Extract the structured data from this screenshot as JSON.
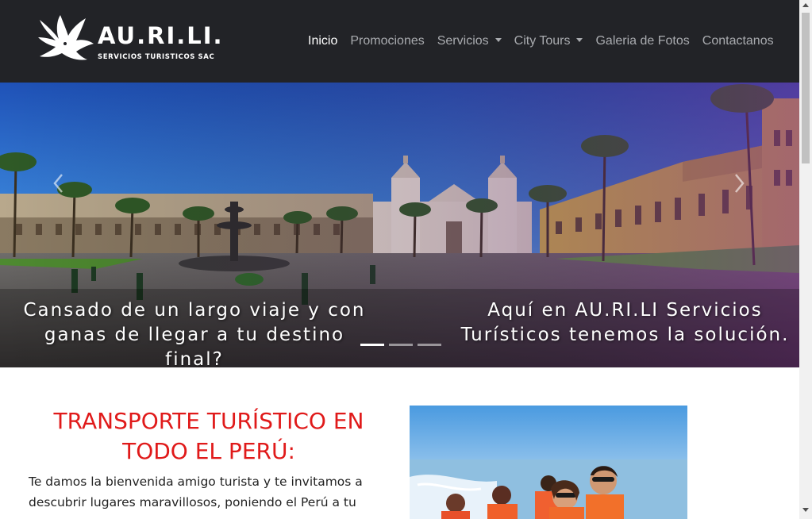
{
  "navbar": {
    "logo": {
      "title": "AU.RI.LI.",
      "subtitle": "SERVICIOS TURISTICOS SAC",
      "icon": "bird-logo-icon"
    },
    "items": [
      {
        "label": "Inicio",
        "active": true,
        "dropdown": false
      },
      {
        "label": "Promociones",
        "active": false,
        "dropdown": false
      },
      {
        "label": "Servicios",
        "active": false,
        "dropdown": true
      },
      {
        "label": "City Tours",
        "active": false,
        "dropdown": true
      },
      {
        "label": "Galeria de Fotos",
        "active": false,
        "dropdown": false
      },
      {
        "label": "Contactanos",
        "active": false,
        "dropdown": false
      }
    ]
  },
  "carousel": {
    "caption_left": "Cansado de un largo viaje y con ganas de llegar a tu destino final?",
    "caption_right": "Aquí en AU.RI.LI Servicios Turísticos tenemos la solución.",
    "slide_count": 3,
    "active_slide": 1,
    "prev_icon": "chevron-left-icon",
    "next_icon": "chevron-right-icon"
  },
  "content": {
    "heading": "TRANSPORTE TURÍSTICO EN TODO EL PERÚ:",
    "intro": "Te damos la bienvenida amigo turista y te invitamos a descubrir lugares maravillosos, poniendo el Perú a tu"
  },
  "colors": {
    "navbar_bg": "#222327",
    "nav_link": "#a9abaf",
    "nav_active": "#ffffff",
    "heading_red": "#e01a1a"
  }
}
